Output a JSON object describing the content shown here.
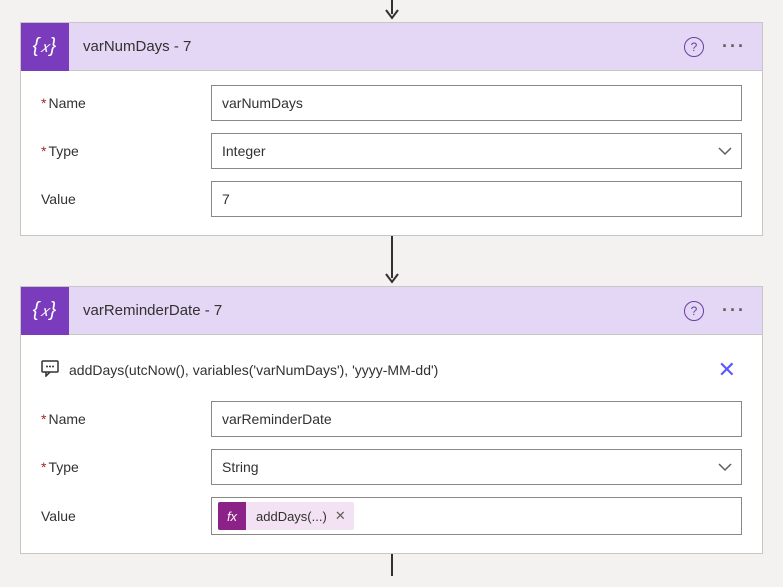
{
  "card1": {
    "title": "varNumDays - 7",
    "icon": "{x}",
    "name_label": "Name",
    "name_value": "varNumDays",
    "type_label": "Type",
    "type_value": "Integer",
    "value_label": "Value",
    "value_value": "7"
  },
  "card2": {
    "title": "varReminderDate - 7",
    "icon": "{x}",
    "comment": "addDays(utcNow(), variables('varNumDays'), 'yyyy-MM-dd')",
    "name_label": "Name",
    "name_value": "varReminderDate",
    "type_label": "Type",
    "type_value": "String",
    "value_label": "Value",
    "fx_badge": "fx",
    "fx_text": "addDays(...)"
  }
}
